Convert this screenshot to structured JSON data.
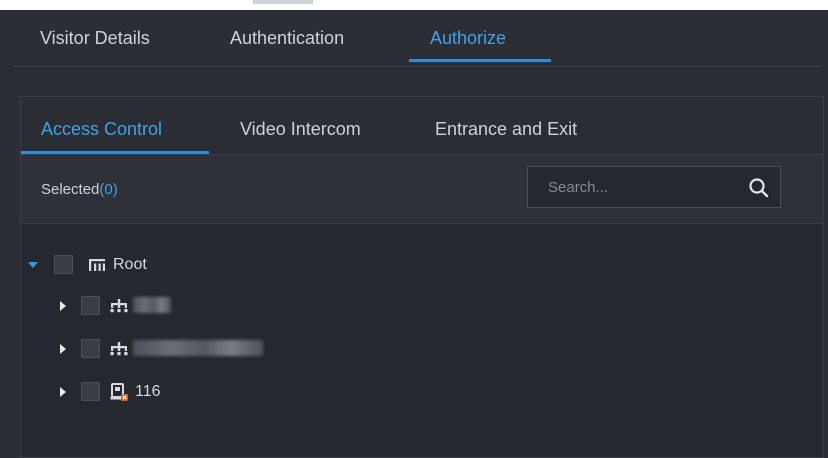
{
  "main_tabs": [
    {
      "label": "Visitor Details",
      "active": false
    },
    {
      "label": "Authentication",
      "active": false
    },
    {
      "label": "Authorize",
      "active": true
    }
  ],
  "sub_tabs": [
    {
      "label": "Access Control",
      "active": true
    },
    {
      "label": "Video Intercom",
      "active": false
    },
    {
      "label": "Entrance and Exit",
      "active": false
    }
  ],
  "toolbar": {
    "selected_label": "Selected",
    "selected_count": "(0)",
    "search_placeholder": "Search..."
  },
  "tree": {
    "root_label": "Root",
    "children": [
      {
        "label": "",
        "redacted": true
      },
      {
        "label": "",
        "redacted": true
      },
      {
        "label": "116",
        "redacted": false
      }
    ]
  },
  "colors": {
    "background": "#2b2e34",
    "accent": "#2f8fd8",
    "active_text": "#3ea3e8",
    "device_icon_red": "#e05a2b"
  }
}
